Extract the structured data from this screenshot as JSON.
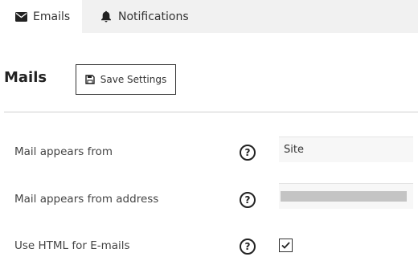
{
  "tabs": [
    {
      "label": "Emails",
      "icon": "envelope-icon",
      "active": true
    },
    {
      "label": "Notifications",
      "icon": "bell-icon",
      "active": false
    }
  ],
  "section": {
    "title": "Mails",
    "save_label": "Save Settings",
    "save_icon": "floppy-disk-icon"
  },
  "fields": {
    "from_name": {
      "label": "Mail appears from",
      "help": "?",
      "value": "Site"
    },
    "from_address": {
      "label": "Mail appears from address",
      "help": "?",
      "value": ""
    },
    "use_html": {
      "label": "Use HTML for E-mails",
      "help": "?",
      "checked": true
    }
  }
}
